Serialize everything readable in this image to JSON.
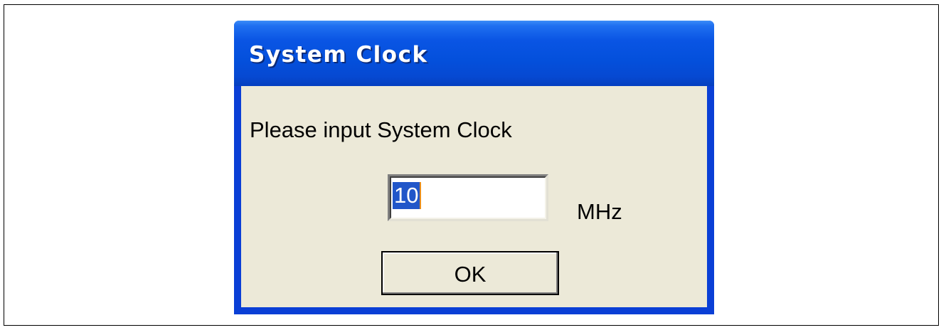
{
  "window": {
    "title": "System Clock"
  },
  "dialog": {
    "prompt": "Please input System Clock",
    "clock_input": {
      "value": "10",
      "selected": true
    },
    "unit_label": "MHz",
    "ok_label": "OK"
  },
  "colors": {
    "titlebar": "#0450dc",
    "window_border": "#0a3fd6",
    "client_background": "#ece9d8",
    "selection_highlight": "#2156c9",
    "caret": "#e88e1d"
  }
}
